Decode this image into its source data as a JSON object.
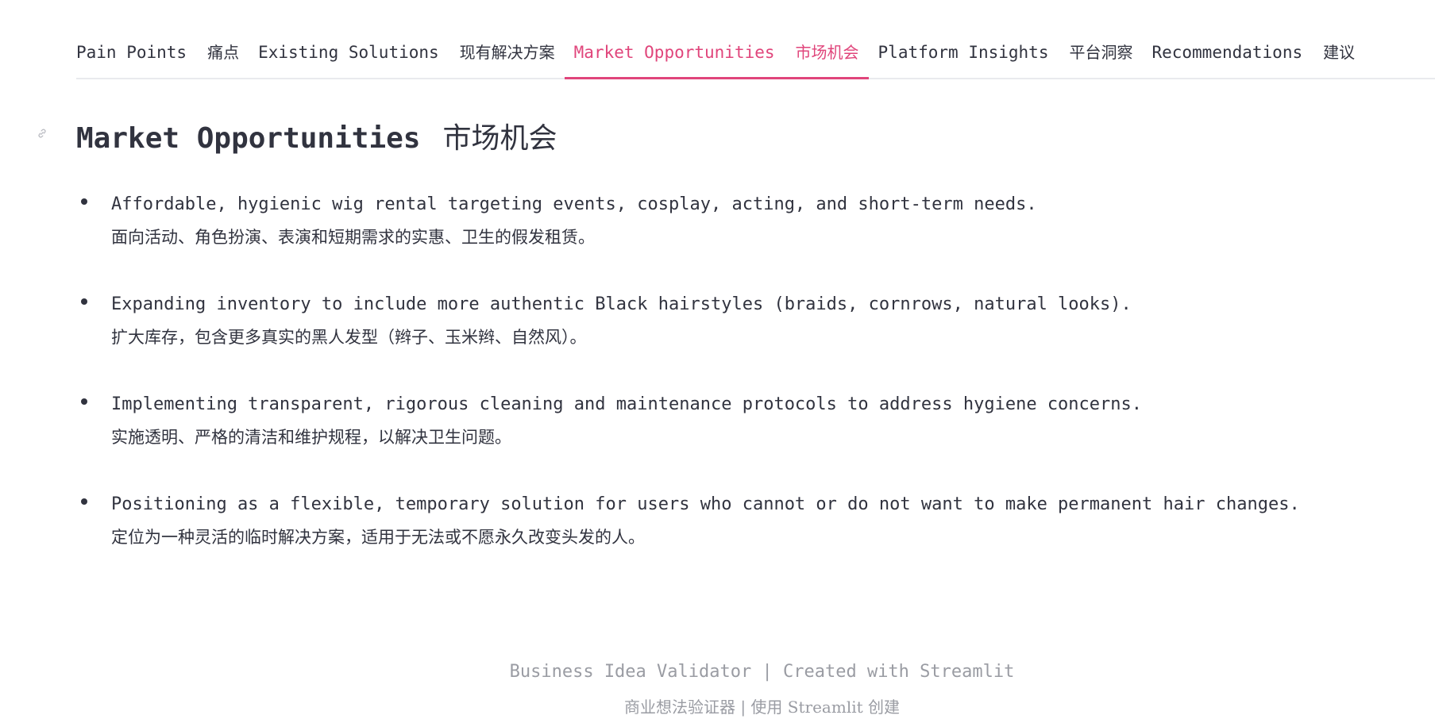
{
  "tabs": [
    {
      "en": "Pain Points",
      "zh": "痛点"
    },
    {
      "en": "Existing Solutions",
      "zh": "现有解决方案"
    },
    {
      "en": "Market Opportunities",
      "zh": "市场机会"
    },
    {
      "en": "Platform Insights",
      "zh": "平台洞察"
    },
    {
      "en": "Recommendations",
      "zh": "建议"
    }
  ],
  "active_tab_index": 2,
  "section": {
    "title_en": "Market Opportunities",
    "title_zh": "市场机会"
  },
  "bullets": [
    {
      "en": "Affordable, hygienic wig rental targeting events, cosplay, acting, and short-term needs.",
      "zh": "面向活动、角色扮演、表演和短期需求的实惠、卫生的假发租赁。"
    },
    {
      "en": "Expanding inventory to include more authentic Black hairstyles (braids, cornrows, natural looks).",
      "zh": "扩大库存，包含更多真实的黑人发型（辫子、玉米辫、自然风）。"
    },
    {
      "en": "Implementing transparent, rigorous cleaning and maintenance protocols to address hygiene concerns.",
      "zh": "实施透明、严格的清洁和维护规程，以解决卫生问题。"
    },
    {
      "en": "Positioning as a flexible, temporary solution for users who cannot or do not want to make permanent hair changes.",
      "zh": "定位为一种灵活的临时解决方案，适用于无法或不愿永久改变头发的人。"
    }
  ],
  "footer": {
    "line_en": "Business Idea Validator | Created with Streamlit",
    "line_zh": "商业想法验证器 | 使用 Streamlit 创建"
  },
  "colors": {
    "accent": "#e0457b",
    "text": "#31333f",
    "muted": "#9a9ca3",
    "divider": "#e9eaee"
  },
  "icons": {
    "heading_anchor": "link-icon"
  }
}
